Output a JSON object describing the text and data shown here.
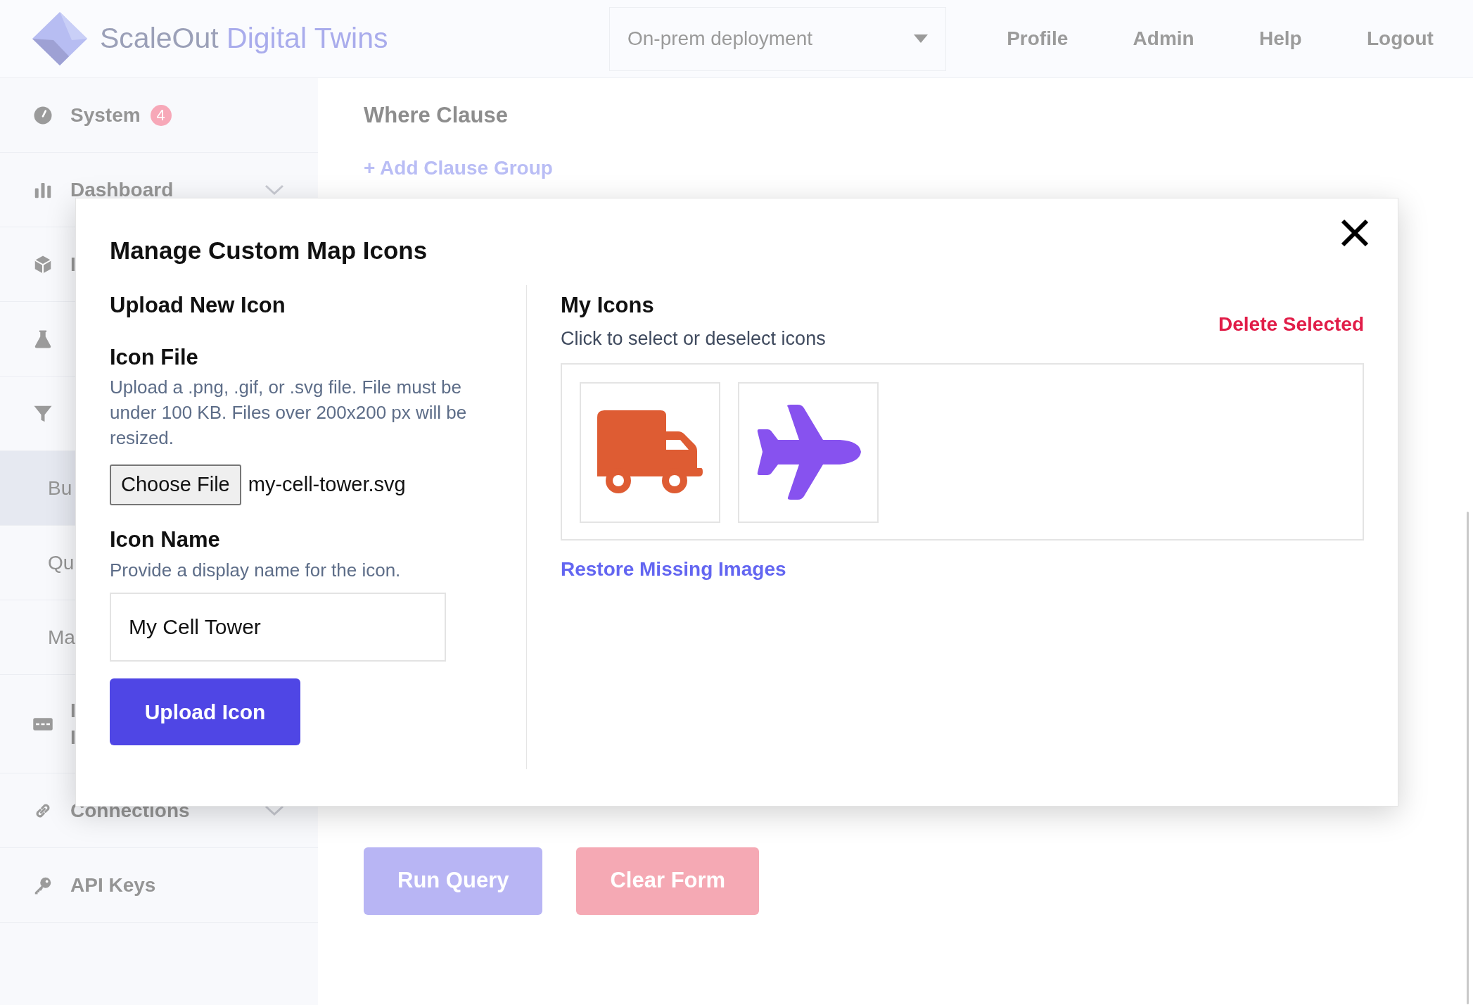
{
  "header": {
    "brand_primary": "ScaleOut",
    "brand_secondary": "Digital Twins",
    "deployment": "On-prem deployment",
    "nav": [
      "Profile",
      "Admin",
      "Help",
      "Logout"
    ]
  },
  "sidebar": {
    "items": [
      {
        "kind": "section",
        "lines": [
          "System"
        ],
        "badge": "4",
        "selected": false
      },
      {
        "kind": "section",
        "lines": [
          "Dashboard"
        ],
        "chevron": true,
        "selected": false
      },
      {
        "kind": "section",
        "lines": [
          "I"
        ],
        "selected": false
      },
      {
        "kind": "section",
        "selected": false
      },
      {
        "kind": "section",
        "selected": false
      },
      {
        "kind": "subitem",
        "lines": [
          "Bu"
        ],
        "selected": true
      },
      {
        "kind": "subitem",
        "lines": [
          "Qu"
        ],
        "selected": false
      },
      {
        "kind": "subitem",
        "lines": [
          "Ma"
        ],
        "selected": false
      },
      {
        "kind": "section",
        "lines": [
          "I",
          "I"
        ],
        "selected": false
      },
      {
        "kind": "section",
        "lines": [
          "Connections"
        ],
        "chevron": true,
        "selected": false
      },
      {
        "kind": "section",
        "lines": [
          "API Keys"
        ],
        "selected": false
      }
    ]
  },
  "main": {
    "section_title": "Where Clause",
    "add_link": "+ Add Clause Group",
    "buttons": [
      {
        "label": "Run Query",
        "kind": "primary"
      },
      {
        "label": "Clear Form",
        "kind": "danger"
      }
    ]
  },
  "modal": {
    "title": "Manage Custom Map Icons",
    "upload": {
      "heading": "Upload New Icon",
      "file_label": "Icon File",
      "file_help": "Upload a .png, .gif, or .svg file. File must be under 100 KB. Files over 200x200 px will be resized.",
      "choose_button": "Choose File",
      "file_name": "my-cell-tower.svg",
      "name_label": "Icon Name",
      "name_help": "Provide a display name for the icon.",
      "name_value": "My Cell Tower",
      "submit": "Upload Icon"
    },
    "my_icons": {
      "heading": "My Icons",
      "help": "Click to select or deselect icons",
      "delete": "Delete Selected",
      "restore": "Restore Missing Images",
      "icons": [
        {
          "kind": "truck",
          "color": "#de5c33",
          "selected": false
        },
        {
          "kind": "plane",
          "color": "#8752ef",
          "selected": false
        }
      ]
    }
  }
}
